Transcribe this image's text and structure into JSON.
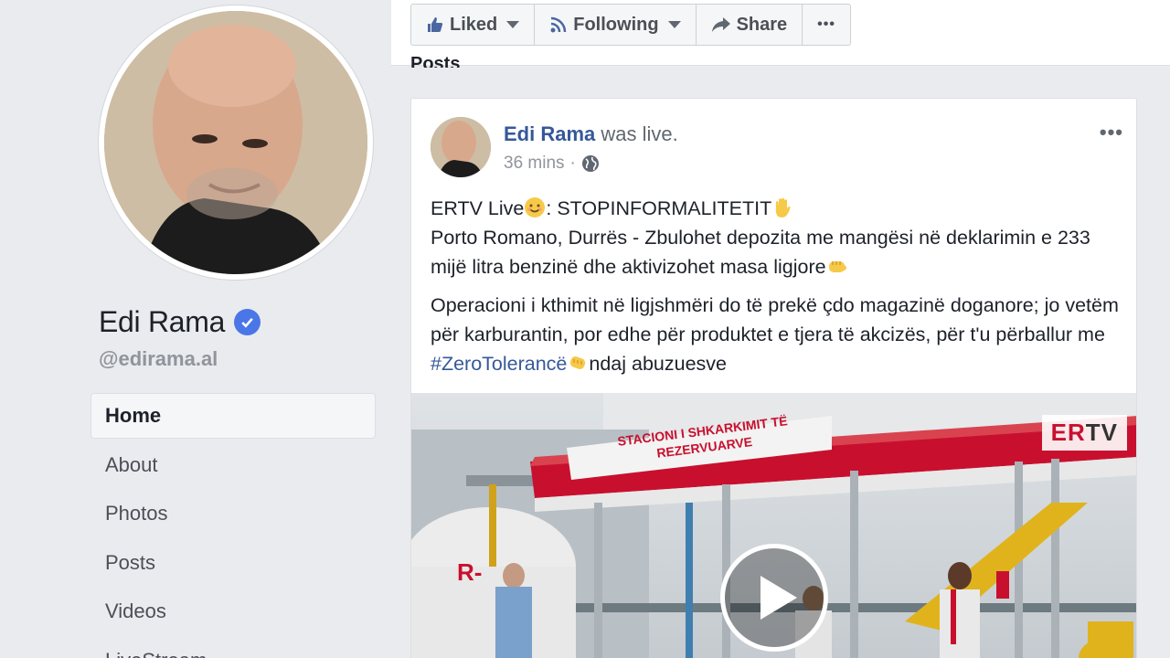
{
  "profile": {
    "name": "Edi Rama",
    "handle": "@edirama.al"
  },
  "nav": {
    "items": [
      {
        "label": "Home",
        "active": true
      },
      {
        "label": "About",
        "active": false
      },
      {
        "label": "Photos",
        "active": false
      },
      {
        "label": "Posts",
        "active": false
      },
      {
        "label": "Videos",
        "active": false
      },
      {
        "label": "LiveStream",
        "active": false
      }
    ]
  },
  "actions": {
    "liked": "Liked",
    "following": "Following",
    "share": "Share",
    "more": "•••"
  },
  "section": {
    "posts_heading": "Posts"
  },
  "post": {
    "author": "Edi Rama",
    "verb": "was live.",
    "time": "36 mins",
    "time_sep": "·",
    "more": "•••",
    "line1_a": "ERTV Live",
    "line1_b": ": STOPINFORMALITETIT",
    "para1": "Porto Romano, Durrës - Zbulohet depozita me mangësi në deklarimin e 233 mijë litra benzinë dhe aktivizohet masa ligjore",
    "para2_a": "Operacioni i kthimit në ligjshmëri do të prekë çdo magazinë doganore; jo vetëm për karburantin, por edhe për produktet e tjera të akcizës, për t'u përballur me ",
    "hashtag": "#ZeroTolerancë",
    "para2_b": "ndaj abuzuesve"
  },
  "video": {
    "logo_a": "ER",
    "logo_b": "TV",
    "sign": "STACIONI I SHKARKIMIT TË REZERVUARVE"
  },
  "colors": {
    "link": "#365899",
    "verified": "#4a76e8",
    "background": "#e9ebee",
    "ertv_red": "#c8102e"
  }
}
